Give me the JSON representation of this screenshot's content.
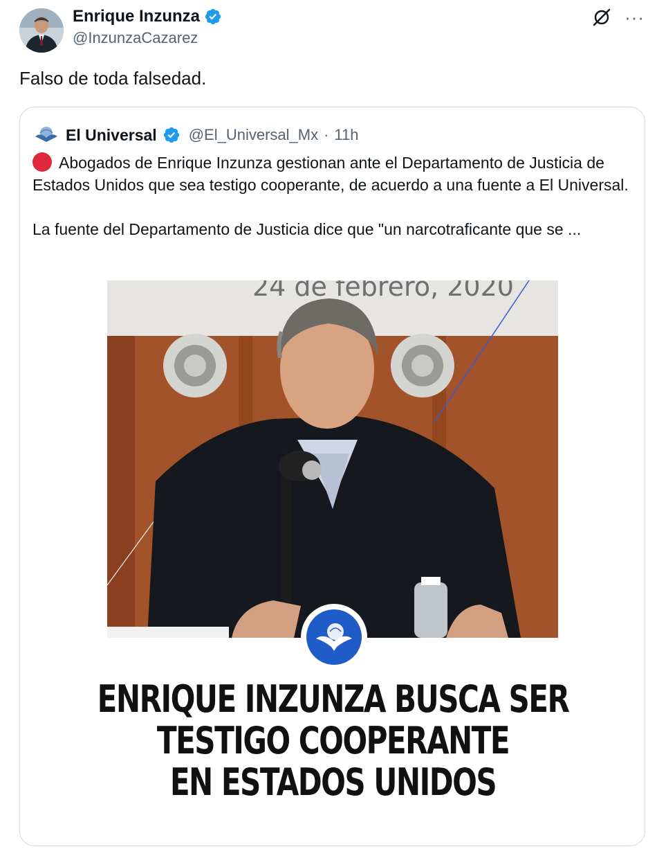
{
  "tweet": {
    "author": {
      "name": "Enrique Inzunza",
      "handle": "@InzunzaCazarez",
      "verified": true,
      "avatar_icon": "profile-photo"
    },
    "text": "Falso de toda falsedad.",
    "actions": {
      "grok_icon": "grok-icon",
      "more_icon": "more-icon",
      "more_label": "···"
    }
  },
  "quote": {
    "author": {
      "name": "El Universal",
      "handle": "@El_Universal_Mx",
      "separator": "·",
      "time": "11h",
      "verified": true,
      "avatar_icon": "el-universal-logo"
    },
    "paragraph_1": "Abogados de Enrique Inzunza gestionan ante el Departamento de Justicia de Estados Unidos que sea testigo cooperante, de acuerdo a una fuente a El Universal.",
    "paragraph_2": "La fuente del Departamento de Justicia dice que \"un narcotraficante que se ...",
    "bullet_icon": "red-circle-emoji",
    "media": {
      "photo_backdrop_text": "24 de febrero, 2020",
      "headline_lines": [
        "ENRIQUE INZUNZA BUSCA SER",
        "TESTIGO COOPERANTE",
        "EN ESTADOS UNIDOS"
      ],
      "emblem_icon": "el-universal-eagle-emblem"
    }
  },
  "colors": {
    "verified_blue": "#1d9bf0",
    "text_primary": "#0f1419",
    "text_secondary": "#536471",
    "border": "#cfd9de",
    "red_dot": "#e0263b",
    "emblem_blue": "#1f5cc8"
  }
}
